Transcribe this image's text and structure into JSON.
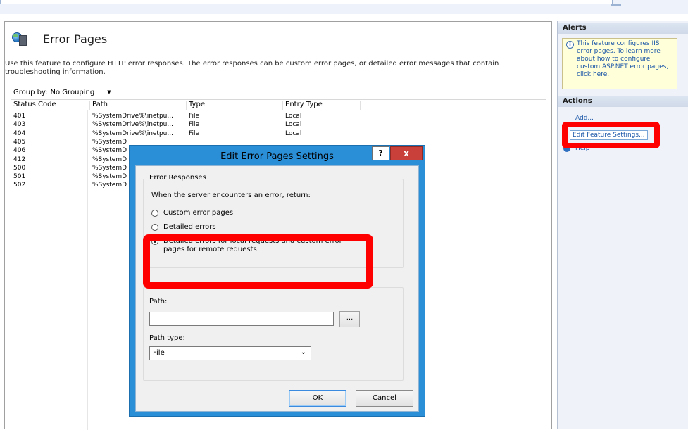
{
  "feature": {
    "title": "Error Pages",
    "description": "Use this feature to configure HTTP error responses. The error responses can be custom error pages, or detailed error messages that contain troubleshooting information.",
    "group_by_label": "Group by:",
    "group_by_value": "No Grouping",
    "columns": [
      "Status Code",
      "Path",
      "Type",
      "Entry Type"
    ],
    "rows": [
      {
        "code": "401",
        "path": "%SystemDrive%\\inetpu...",
        "type": "File",
        "entry": "Local"
      },
      {
        "code": "403",
        "path": "%SystemDrive%\\inetpu...",
        "type": "File",
        "entry": "Local"
      },
      {
        "code": "404",
        "path": "%SystemDrive%\\inetpu...",
        "type": "File",
        "entry": "Local"
      },
      {
        "code": "405",
        "path": "%SystemD",
        "type": "",
        "entry": ""
      },
      {
        "code": "406",
        "path": "%SystemD",
        "type": "",
        "entry": ""
      },
      {
        "code": "412",
        "path": "%SystemD",
        "type": "",
        "entry": ""
      },
      {
        "code": "500",
        "path": "%SystemD",
        "type": "",
        "entry": ""
      },
      {
        "code": "501",
        "path": "%SystemD",
        "type": "",
        "entry": ""
      },
      {
        "code": "502",
        "path": "%SystemD",
        "type": "",
        "entry": ""
      }
    ]
  },
  "right_pane": {
    "alerts_header": "Alerts",
    "alert_text": "This feature configures IIS error pages. To learn more about how to configure custom ASP.NET error pages, click here.",
    "actions_header": "Actions",
    "add_label": "Add...",
    "edit_label": "Edit Feature Settings...",
    "help_label": "Help"
  },
  "dialog": {
    "title": "Edit Error Pages Settings",
    "help_glyph": "?",
    "close_glyph": "x",
    "error_responses_caption": "Error Responses",
    "error_prompt": "When the server encounters an error, return:",
    "options": [
      {
        "label": "Custom error pages",
        "selected": false
      },
      {
        "label": "Detailed errors",
        "selected": false
      },
      {
        "label": "Detailed errors for local requests and custom error pages for remote requests",
        "selected": true
      }
    ],
    "default_page_caption": "Default Page",
    "path_label": "Path:",
    "path_value": "",
    "browse_label": "...",
    "path_type_label": "Path type:",
    "path_type_value": "File",
    "ok_label": "OK",
    "cancel_label": "Cancel"
  },
  "colors": {
    "highlight": "#ff0000",
    "dialog_frame": "#2b8fd8",
    "link": "#1a56a8"
  }
}
